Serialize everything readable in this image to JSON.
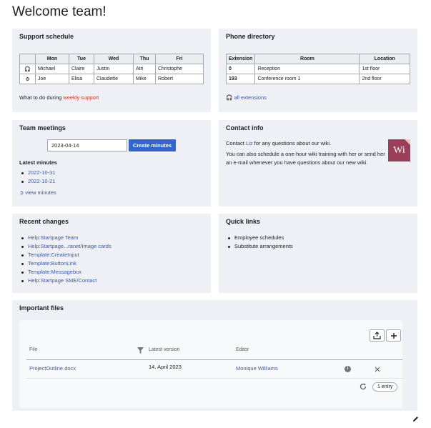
{
  "page": {
    "title": "Welcome team!"
  },
  "support": {
    "title": "Support schedule",
    "headers": [
      "",
      "Mon",
      "Tue",
      "Wed",
      "Thu",
      "Fri"
    ],
    "rows": [
      {
        "icon": "headset-icon",
        "glyph": "🎧",
        "cells": [
          "Michael",
          "Claire",
          "Justin",
          "Atri",
          "Christophe"
        ]
      },
      {
        "icon": "gears-icon",
        "glyph": "⚙",
        "cells": [
          "Joe",
          "Elisa",
          "Claudette",
          "Mike",
          "Robert"
        ]
      }
    ],
    "footer_text": "What to do during ",
    "footer_link": "weekly support"
  },
  "phone": {
    "title": "Phone directory",
    "headers": [
      "Extension",
      "Room",
      "Location"
    ],
    "rows": [
      [
        "0",
        "Reception",
        "1st floor"
      ],
      [
        "193",
        "Conference room 1",
        "2nd floor"
      ]
    ],
    "all_link": "all extensions"
  },
  "meetings": {
    "title": "Team meetings",
    "date_value": "2023-04-14",
    "create_label": "Create minutes",
    "latest_label": "Latest minutes",
    "items": [
      "2022-10-31",
      "2022-10-21"
    ],
    "view_link": "view minutes"
  },
  "contact": {
    "title": "Contact info",
    "line1_pre": "Contact ",
    "line1_name": "Liz",
    "line1_post": " for any questions about our wiki.",
    "line2": "You can also schedule a one-hour wiki training with her or send her an e-mail whenever you have questions about our new wiki.",
    "logo_text": "Wi"
  },
  "recent": {
    "title": "Recent changes",
    "items": [
      "Help:Startpage Team",
      "Help:Startpage...ranet/Image cards",
      "Template:CreateInput",
      "Template:ButtonLink",
      "Template:Messagebox",
      "Help:Startpage SME/Contact"
    ]
  },
  "quick": {
    "title": "Quick links",
    "items": [
      "Employee schedules",
      "Substitute arrangements"
    ]
  },
  "files": {
    "title": "Important files",
    "headers": {
      "file": "File",
      "version": "Latest version",
      "editor": "Editor"
    },
    "rows": [
      {
        "file": "ProjectOutline.docx",
        "version": "14. April 2023",
        "editor": "Monique Williams"
      }
    ],
    "count": "1 entry"
  },
  "colors": {
    "panel": "#eef0f5",
    "link": "#3e5a9c",
    "accent": "#3366cc",
    "logo": "#9b3e5a"
  }
}
